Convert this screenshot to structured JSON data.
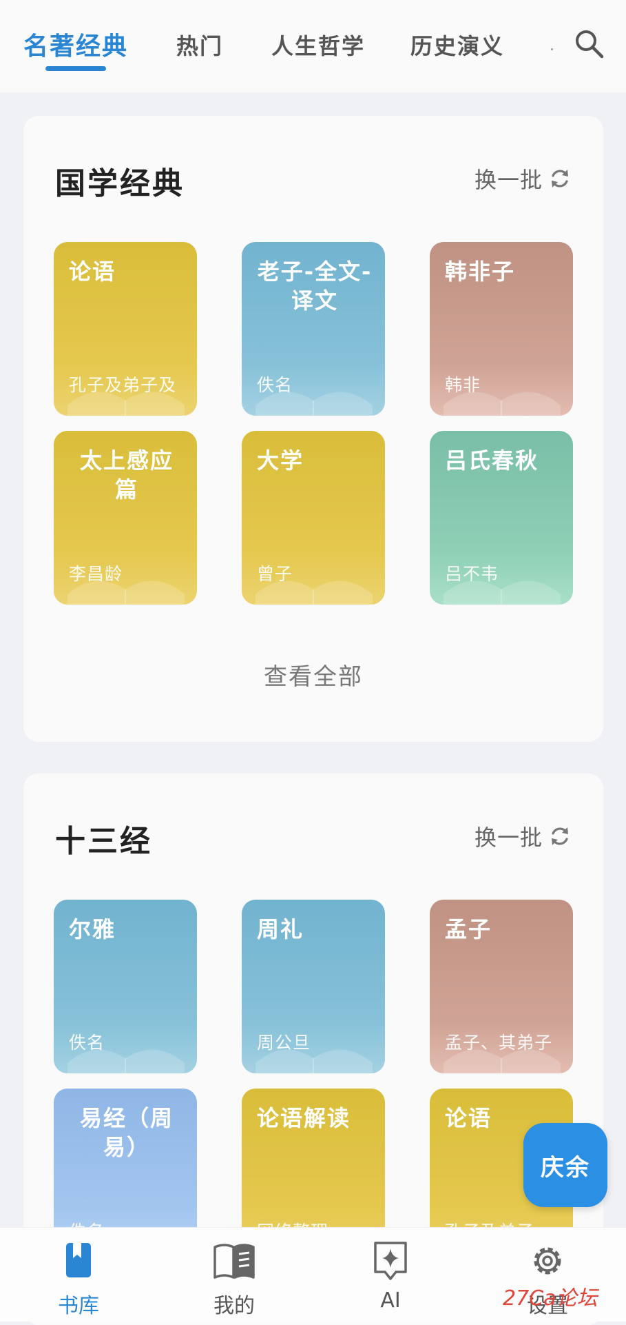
{
  "top_tabs": [
    "名著经典",
    "热门",
    "人生哲学",
    "历史演义"
  ],
  "sections": [
    {
      "title": "国学经典",
      "refresh_label": "换一批",
      "view_all": "查看全部",
      "books": [
        {
          "title": "论语",
          "author": "孔子及弟子及",
          "color": "yellow"
        },
        {
          "title": "老子-全文-译文",
          "author": "佚名",
          "color": "blue"
        },
        {
          "title": "韩非子",
          "author": "韩非",
          "color": "brown"
        },
        {
          "title": "太上感应篇",
          "author": "李昌龄",
          "color": "yellow"
        },
        {
          "title": "大学",
          "author": "曾子",
          "color": "yellow"
        },
        {
          "title": "吕氏春秋",
          "author": "吕不韦",
          "color": "green"
        }
      ]
    },
    {
      "title": "十三经",
      "refresh_label": "换一批",
      "books": [
        {
          "title": "尔雅",
          "author": "佚名",
          "color": "blue"
        },
        {
          "title": "周礼",
          "author": "周公旦",
          "color": "blue"
        },
        {
          "title": "孟子",
          "author": "孟子、其弟子",
          "color": "brown"
        },
        {
          "title": "易经（周易）",
          "author": "佚名",
          "color": "lightblue"
        },
        {
          "title": "论语解读",
          "author": "网络整理",
          "color": "yellow"
        },
        {
          "title": "论语",
          "author": "孔子及弟子",
          "color": "yellow"
        }
      ]
    }
  ],
  "fab_label": "庆余",
  "bottom_nav": [
    {
      "label": "书库",
      "icon": "bookmark-book-icon",
      "active": true
    },
    {
      "label": "我的",
      "icon": "open-book-icon",
      "active": false
    },
    {
      "label": "AI",
      "icon": "ai-sparkle-icon",
      "active": false
    },
    {
      "label": "设置",
      "icon": "gear-icon",
      "active": false
    }
  ],
  "watermark": "27Ca论坛",
  "colors": {
    "accent": "#2a86d3",
    "fab": "#2b8fe4"
  }
}
